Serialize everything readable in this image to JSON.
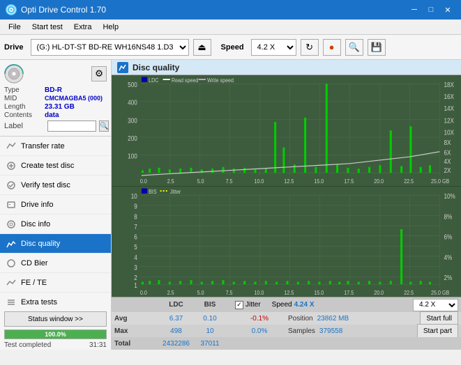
{
  "app": {
    "title": "Opti Drive Control 1.70",
    "icon": "disc-icon"
  },
  "title_buttons": {
    "minimize": "─",
    "maximize": "□",
    "close": "✕"
  },
  "menu": {
    "items": [
      "File",
      "Start test",
      "Extra",
      "Help"
    ]
  },
  "toolbar": {
    "drive_label": "Drive",
    "drive_value": "(G:)  HL-DT-ST BD-RE  WH16NS48 1.D3",
    "speed_label": "Speed",
    "speed_value": "4.2 X"
  },
  "disc": {
    "type_label": "Type",
    "type_value": "BD-R",
    "mid_label": "MID",
    "mid_value": "CMCMAGBA5 (000)",
    "length_label": "Length",
    "length_value": "23.31 GB",
    "contents_label": "Contents",
    "contents_value": "data",
    "label_label": "Label",
    "label_value": ""
  },
  "nav": {
    "items": [
      {
        "id": "transfer-rate",
        "label": "Transfer rate",
        "active": false
      },
      {
        "id": "create-test-disc",
        "label": "Create test disc",
        "active": false
      },
      {
        "id": "verify-test-disc",
        "label": "Verify test disc",
        "active": false
      },
      {
        "id": "drive-info",
        "label": "Drive info",
        "active": false
      },
      {
        "id": "disc-info",
        "label": "Disc info",
        "active": false
      },
      {
        "id": "disc-quality",
        "label": "Disc quality",
        "active": true
      },
      {
        "id": "cd-bier",
        "label": "CD Bier",
        "active": false
      },
      {
        "id": "fe-te",
        "label": "FE / TE",
        "active": false
      },
      {
        "id": "extra-tests",
        "label": "Extra tests",
        "active": false
      }
    ]
  },
  "disc_quality": {
    "title": "Disc quality",
    "legend": {
      "ldc": "LDC",
      "read_speed": "Read speed",
      "write_speed": "Write speed",
      "bis": "BIS",
      "jitter": "Jitter"
    },
    "chart1": {
      "y_max": 500,
      "y_labels": [
        "500",
        "400",
        "300",
        "200",
        "100"
      ],
      "right_labels": [
        "18X",
        "16X",
        "14X",
        "12X",
        "10X",
        "8X",
        "6X",
        "4X",
        "2X"
      ],
      "x_labels": [
        "0.0",
        "2.5",
        "5.0",
        "7.5",
        "10.0",
        "12.5",
        "15.0",
        "17.5",
        "20.0",
        "22.5",
        "25.0 GB"
      ]
    },
    "chart2": {
      "y_max": 10,
      "y_labels": [
        "10",
        "9",
        "8",
        "7",
        "6",
        "5",
        "4",
        "3",
        "2",
        "1"
      ],
      "right_labels": [
        "10%",
        "8%",
        "6%",
        "4%",
        "2%"
      ],
      "x_labels": [
        "0.0",
        "2.5",
        "5.0",
        "7.5",
        "10.0",
        "12.5",
        "15.0",
        "17.5",
        "20.0",
        "22.5",
        "25.0 GB"
      ]
    },
    "stats": {
      "ldc_label": "LDC",
      "bis_label": "BIS",
      "jitter_label": "Jitter",
      "speed_label": "Speed",
      "speed_value": "4.24 X",
      "jitter_checked": true,
      "avg_label": "Avg",
      "avg_ldc": "6.37",
      "avg_bis": "0.10",
      "avg_jitter": "-0.1%",
      "max_label": "Max",
      "max_ldc": "498",
      "max_bis": "10",
      "max_jitter": "0.0%",
      "total_label": "Total",
      "total_ldc": "2432286",
      "total_bis": "37011",
      "position_label": "Position",
      "position_value": "23862 MB",
      "samples_label": "Samples",
      "samples_value": "379558"
    },
    "speed_select_value": "4.2 X",
    "start_full_label": "Start full",
    "start_part_label": "Start part"
  },
  "status": {
    "status_window_label": "Status window >>",
    "status_text": "Test completed",
    "progress_value": 100,
    "progress_label": "100.0%",
    "time_label": "31:31"
  }
}
